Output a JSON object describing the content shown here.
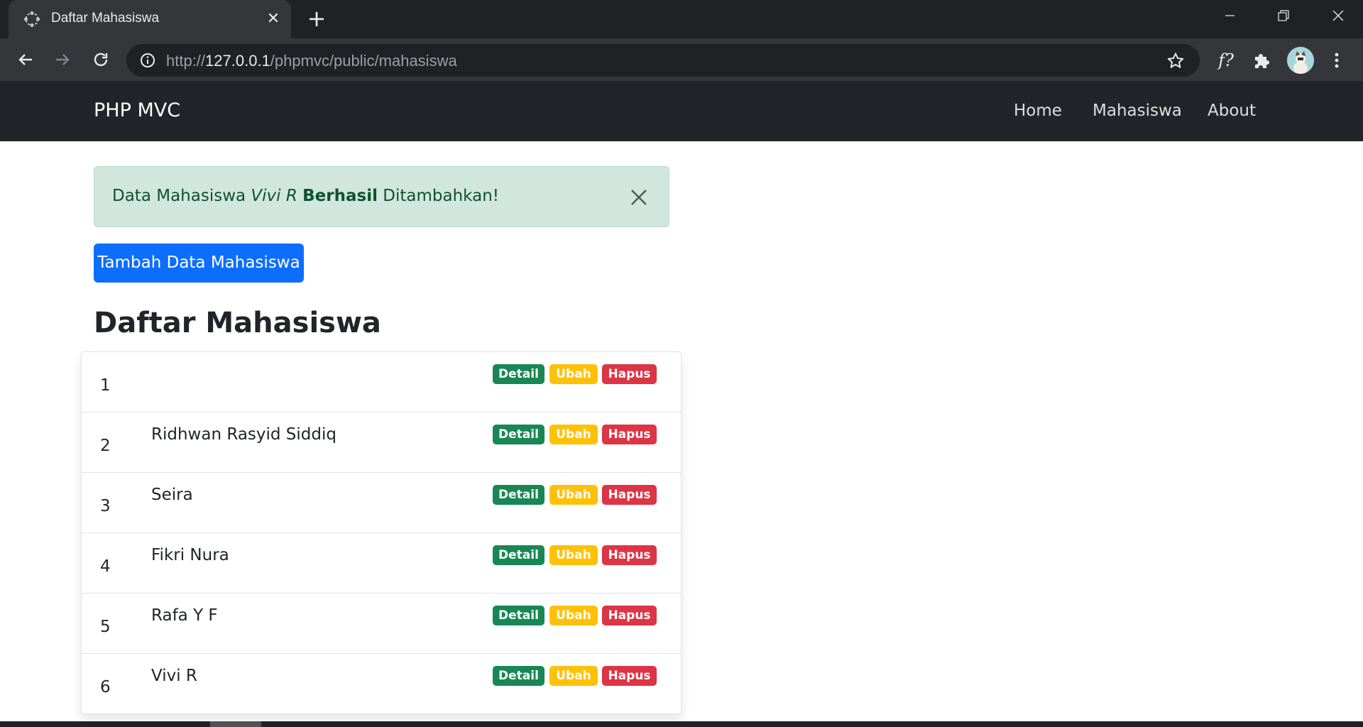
{
  "browser": {
    "tab_title": "Daftar Mahasiswa",
    "url_scheme": "http://",
    "url_host": "127.0.0.1",
    "url_path": "/phpmvc/public/mahasiswa",
    "extension_label": "f?"
  },
  "navbar": {
    "brand": "PHP MVC",
    "links": [
      "Home",
      "Mahasiswa",
      "About"
    ]
  },
  "alert": {
    "prefix": "Data Mahasiswa ",
    "name": "Vivi R",
    "space1": " ",
    "status": "Berhasil",
    "suffix": " Ditambahkan!"
  },
  "add_button": "Tambah Data Mahasiswa",
  "heading": "Daftar Mahasiswa",
  "badges": {
    "detail": "Detail",
    "ubah": "Ubah",
    "hapus": "Hapus"
  },
  "students": [
    {
      "no": "1",
      "name": ""
    },
    {
      "no": "2",
      "name": "Ridhwan Rasyid Siddiq"
    },
    {
      "no": "3",
      "name": "Seira"
    },
    {
      "no": "4",
      "name": "Fikri Nura"
    },
    {
      "no": "5",
      "name": "Rafa Y F"
    },
    {
      "no": "6",
      "name": "Vivi R"
    }
  ],
  "colors": {
    "navbar": "#212529",
    "primary": "#0d6efd",
    "success": "#198754",
    "warning": "#ffc107",
    "danger": "#dc3545",
    "alert_bg": "#d1e7dd"
  }
}
